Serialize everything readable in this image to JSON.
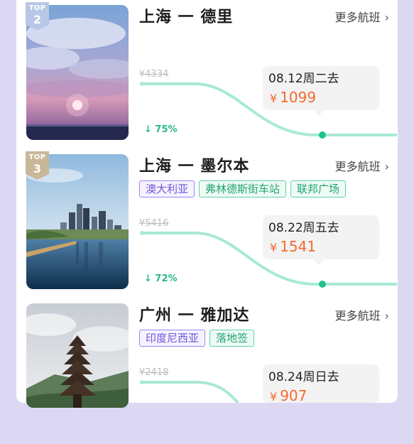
{
  "cards": [
    {
      "rank": "2",
      "top_label": "TOP",
      "route": "上海 一 德里",
      "more_label": "更多航班",
      "tags": [],
      "original_price": "¥4334",
      "drop_percent": "75%",
      "date": "08.12周二去",
      "currency": "¥",
      "price": "1099"
    },
    {
      "rank": "3",
      "top_label": "TOP",
      "route": "上海 一 墨尔本",
      "more_label": "更多航班",
      "tags": [
        {
          "label": "澳大利亚",
          "style": "purple"
        },
        {
          "label": "弗林德斯街车站",
          "style": "green"
        },
        {
          "label": "联邦广场",
          "style": "green"
        }
      ],
      "original_price": "¥5416",
      "drop_percent": "72%",
      "date": "08.22周五去",
      "currency": "¥",
      "price": "1541"
    },
    {
      "route": "广州 一 雅加达",
      "more_label": "更多航班",
      "tags": [
        {
          "label": "印度尼西亚",
          "style": "purple"
        },
        {
          "label": "落地签",
          "style": "green"
        }
      ],
      "original_price": "¥2418",
      "date": "08.24周日去",
      "currency": "¥",
      "price": "907"
    }
  ],
  "colors": {
    "price": "#f36b2f",
    "curve": "#a8ead3",
    "curve_dot": "#1ec48a",
    "badge": "#c9b79a",
    "tag_purple": "#6f55d8",
    "tag_green": "#1fa574"
  }
}
